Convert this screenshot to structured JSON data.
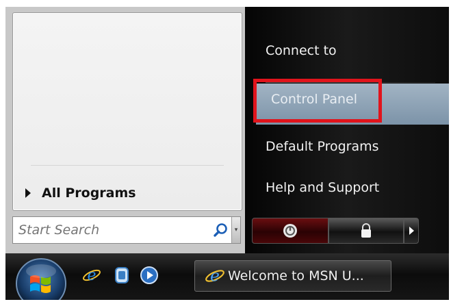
{
  "start_menu": {
    "left": {
      "all_programs_label": "All Programs"
    },
    "search": {
      "placeholder": "Start Search"
    },
    "right": {
      "items": [
        {
          "label": "Connect to"
        },
        {
          "label": "Control Panel"
        },
        {
          "label": "Default Programs"
        },
        {
          "label": "Help and Support"
        }
      ],
      "highlighted_item": "Control Panel"
    }
  },
  "taskbar": {
    "quick_launch": [
      "internet-explorer-icon",
      "switch-windows-icon",
      "media-player-icon"
    ],
    "task_button_label": "Welcome to MSN U..."
  },
  "colors": {
    "annotation_red": "#e1141c",
    "highlight_blue": "#8ea3b7",
    "right_pane_black": "#0b0b0b",
    "power_red": "#5a0a0c"
  }
}
